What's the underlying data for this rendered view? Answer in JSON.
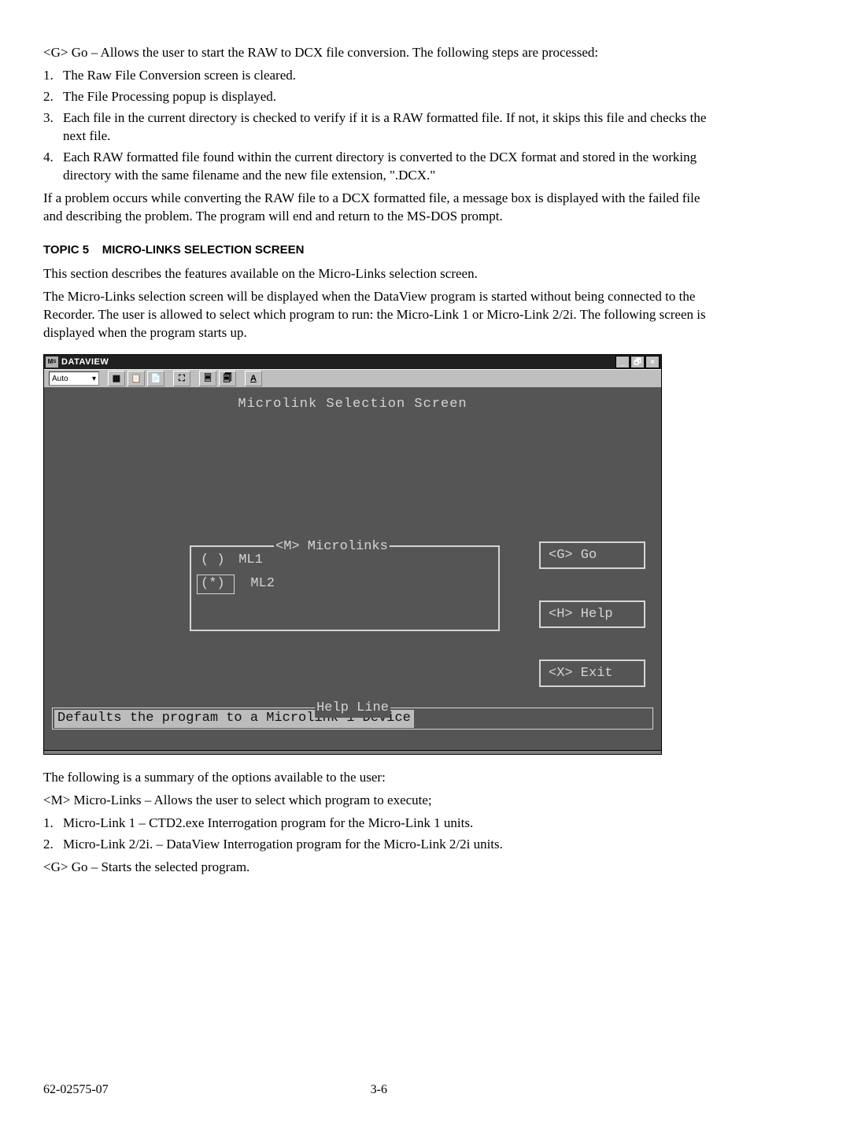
{
  "intro": {
    "go_line": "<G> Go – Allows the user to start the RAW to DCX file conversion. The following steps are processed:",
    "steps": [
      "The Raw File Conversion screen is cleared.",
      "The File Processing popup is displayed.",
      "Each file in the current directory is checked to verify if it is a RAW formatted file. If not, it skips this file and checks the next file.",
      "Each RAW formatted file found within the current directory is converted to the DCX format and stored in the working directory with the same filename and the new file extension, \".DCX.\""
    ],
    "problem": "If a problem occurs while converting the RAW file to a DCX formatted file, a message box is displayed with the failed file and describing the problem. The program will end and return to the MS-DOS prompt."
  },
  "topic": {
    "num": "TOPIC 5",
    "title": "MICRO-LINKS SELECTION SCREEN",
    "p1": "This section describes the features available on the Micro-Links selection screen.",
    "p2": "The Micro-Links selection screen will be displayed when the DataView program is started without being connected to the Recorder. The user is allowed to select which program to run: the Micro-Link 1 or Micro-Link 2/2i. The following screen is displayed when the program starts up."
  },
  "window": {
    "title": "DATAVIEW",
    "toolbar_select": "Auto",
    "screen_title": "Microlink Selection Screen",
    "microlinks_label": "<M> Microlinks",
    "opt1_mark": "( )",
    "opt1_label": "ML1",
    "opt2_mark": "(*)",
    "opt2_label": "ML2",
    "btn_go": "<G> Go",
    "btn_help": "<H> Help",
    "btn_exit": "<X> Exit",
    "help_label": "Help Line",
    "help_text": "Defaults the program to a Microlink 1 Device"
  },
  "after": {
    "summary": "The following is a summary of the options available to the user:",
    "m_line": "<M> Micro-Links – Allows the user to select which program to execute;",
    "items": [
      "Micro-Link 1 – CTD2.exe Interrogation program for the Micro-Link 1 units.",
      "Micro-Link 2/2i. – DataView Interrogation program for the Micro-Link 2/2i units."
    ],
    "g_line": "<G> Go – Starts the selected program."
  },
  "footer": {
    "left": "62-02575-07",
    "center": "3-6"
  }
}
